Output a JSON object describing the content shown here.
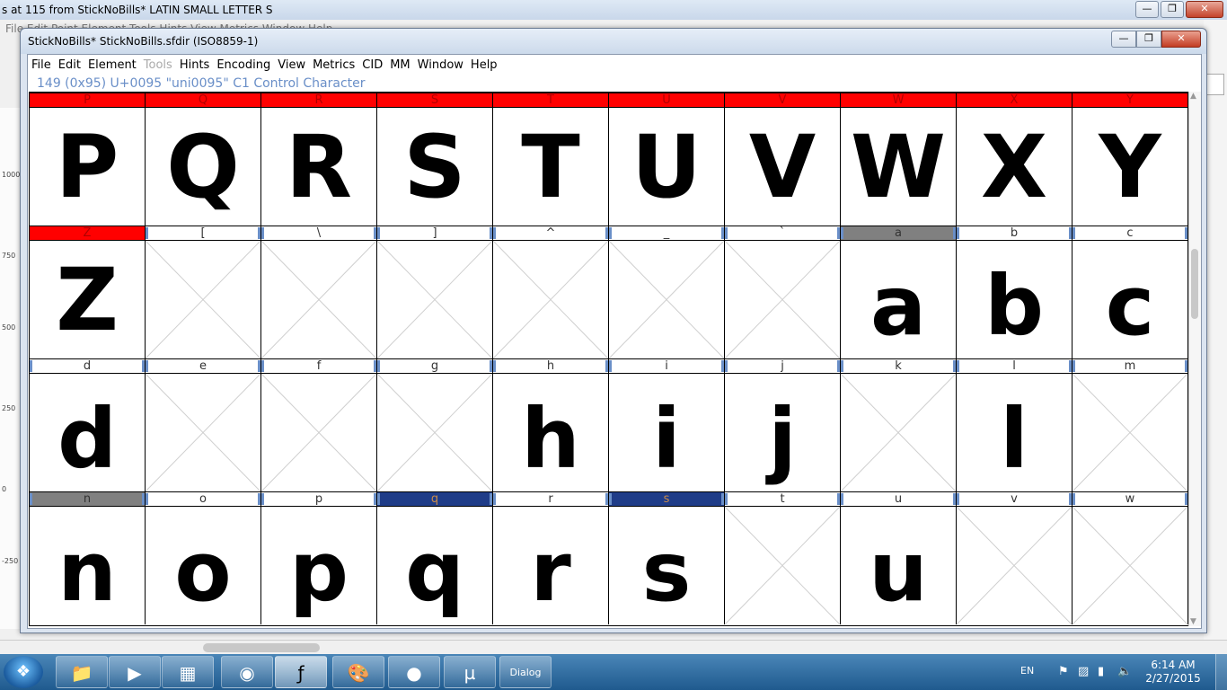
{
  "background_window": {
    "title": "s at 115 from StickNoBills* LATIN SMALL LETTER S",
    "menu_fragment": "File Edit Point Element Tools Hints View Metrics Window Help",
    "ruler_labels": [
      "1000",
      "750",
      "500",
      "250",
      "0",
      "-250"
    ]
  },
  "font_window": {
    "title": "StickNoBills*  StickNoBills.sfdir (ISO8859-1)",
    "menu": [
      "File",
      "Edit",
      "Element",
      "Tools",
      "Hints",
      "Encoding",
      "View",
      "Metrics",
      "CID",
      "MM",
      "Window",
      "Help"
    ],
    "disabled_menu": [
      "Tools"
    ],
    "info_line": "149 (0x95) U+0095 \"uni0095\" C1 Control Character",
    "rows": [
      [
        {
          "label": "P",
          "glyph": "P",
          "state": "red"
        },
        {
          "label": "Q",
          "glyph": "Q",
          "state": "red"
        },
        {
          "label": "R",
          "glyph": "R",
          "state": "red"
        },
        {
          "label": "S",
          "glyph": "S",
          "state": "red"
        },
        {
          "label": "T",
          "glyph": "T",
          "state": "red"
        },
        {
          "label": "U",
          "glyph": "U",
          "state": "red"
        },
        {
          "label": "V",
          "glyph": "V",
          "state": "red"
        },
        {
          "label": "W",
          "glyph": "W",
          "state": "red"
        },
        {
          "label": "X",
          "glyph": "X",
          "state": "red"
        },
        {
          "label": "Y",
          "glyph": "Y",
          "state": "red"
        }
      ],
      [
        {
          "label": "Z",
          "glyph": "Z",
          "state": "red"
        },
        {
          "label": "[",
          "glyph": "",
          "state": "normal"
        },
        {
          "label": "\\",
          "glyph": "",
          "state": "normal"
        },
        {
          "label": "]",
          "glyph": "",
          "state": "normal"
        },
        {
          "label": "^",
          "glyph": "",
          "state": "normal"
        },
        {
          "label": "_",
          "glyph": "",
          "state": "normal"
        },
        {
          "label": "`",
          "glyph": "",
          "state": "normal"
        },
        {
          "label": "a",
          "glyph": "a",
          "state": "gray"
        },
        {
          "label": "b",
          "glyph": "b",
          "state": "normal"
        },
        {
          "label": "c",
          "glyph": "c",
          "state": "normal"
        }
      ],
      [
        {
          "label": "d",
          "glyph": "d",
          "state": "normal"
        },
        {
          "label": "e",
          "glyph": "",
          "state": "normal"
        },
        {
          "label": "f",
          "glyph": "",
          "state": "normal"
        },
        {
          "label": "g",
          "glyph": "",
          "state": "normal"
        },
        {
          "label": "h",
          "glyph": "h",
          "state": "normal"
        },
        {
          "label": "i",
          "glyph": "i",
          "state": "normal"
        },
        {
          "label": "j",
          "glyph": "j",
          "state": "normal"
        },
        {
          "label": "k",
          "glyph": "",
          "state": "normal"
        },
        {
          "label": "l",
          "glyph": "l",
          "state": "normal"
        },
        {
          "label": "m",
          "glyph": "",
          "state": "normal"
        }
      ],
      [
        {
          "label": "n",
          "glyph": "n",
          "state": "gray"
        },
        {
          "label": "o",
          "glyph": "o",
          "state": "normal"
        },
        {
          "label": "p",
          "glyph": "p",
          "state": "normal"
        },
        {
          "label": "q",
          "glyph": "q",
          "state": "blue"
        },
        {
          "label": "r",
          "glyph": "r",
          "state": "normal"
        },
        {
          "label": "s",
          "glyph": "s",
          "state": "blue"
        },
        {
          "label": "t",
          "glyph": "",
          "state": "normal"
        },
        {
          "label": "u",
          "glyph": "u",
          "state": "normal"
        },
        {
          "label": "v",
          "glyph": "",
          "state": "normal"
        },
        {
          "label": "w",
          "glyph": "",
          "state": "normal"
        }
      ]
    ]
  },
  "taskbar": {
    "buttons": [
      "file-explorer-icon",
      "media-player-icon",
      "app-grid-icon",
      "chrome-icon",
      "fontforge-icon",
      "paint-icon",
      "cat-app-icon",
      "utorrent-icon",
      "dialog-icon"
    ],
    "dialog_label": "Dialog",
    "language": "EN",
    "time": "6:14 AM",
    "date": "2/27/2015"
  },
  "colors": {
    "red": "#ff0000",
    "gray": "#808080",
    "blue": "#1f3c88",
    "info": "#6a8fc8"
  }
}
